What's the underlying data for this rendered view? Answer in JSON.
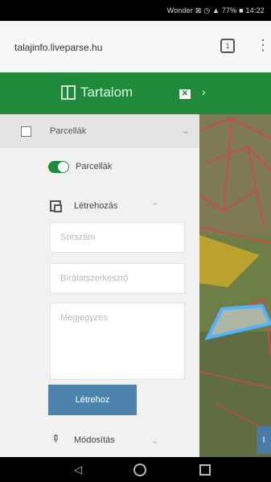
{
  "status": {
    "text": "Wonder ⊠ ◷ ▲ 77% ■ 14:22"
  },
  "browser": {
    "url": "talajinfo.liveparse.hu",
    "tabs_count": "1"
  },
  "toc": {
    "title": "Tartalom"
  },
  "layers": {
    "group_label": "Parcellák",
    "toggle_label": "Parcellák"
  },
  "create": {
    "section_label": "Létrehozás",
    "field1_placeholder": "Sorszám",
    "field2_placeholder": "Bírálatszerkesztő",
    "field3_placeholder": "Megjegyzés",
    "button_label": "Létrehoz"
  },
  "modify": {
    "section_label": "Módosítás"
  },
  "map": {
    "button_label": "I"
  },
  "colors": {
    "green": "#1e8a3a",
    "button_blue": "#4c83ad",
    "map_blue": "#4a7aa8"
  }
}
